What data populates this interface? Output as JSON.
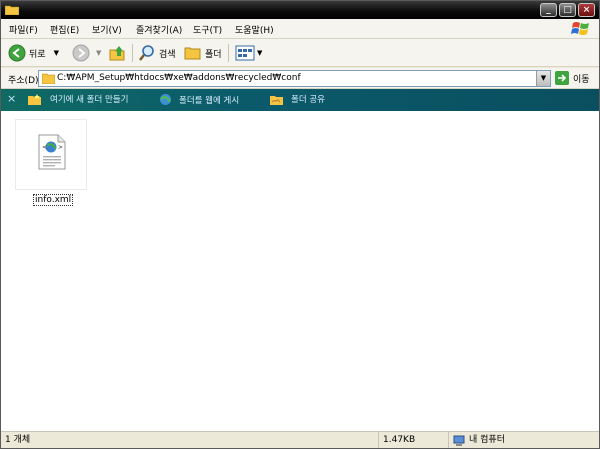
{
  "menu": [
    "파일(F)",
    "편집(E)",
    "보기(V)",
    "즐겨찾기(A)",
    "도구(T)",
    "도움말(H)"
  ],
  "toolbar": {
    "back_label": "뒤로",
    "search_label": "검색",
    "folders_label": "폴더"
  },
  "address": {
    "label": "주소(D)",
    "value": "C:₩APM_Setup₩htdocs₩xe₩addons₩recycled₩conf",
    "go_label": "이동"
  },
  "tasks": [
    "여기에 새 폴더 만들기",
    "폴더를 웹에 게시",
    "폴더 공유"
  ],
  "file": {
    "name": "info.xml"
  },
  "status": {
    "count": "1 개체",
    "size": "1.47KB",
    "location": "내 컴퓨터"
  },
  "colors": {
    "title_bar": "#000000",
    "task_bar": "#0f6a63",
    "address_border": "#7f9db9"
  }
}
